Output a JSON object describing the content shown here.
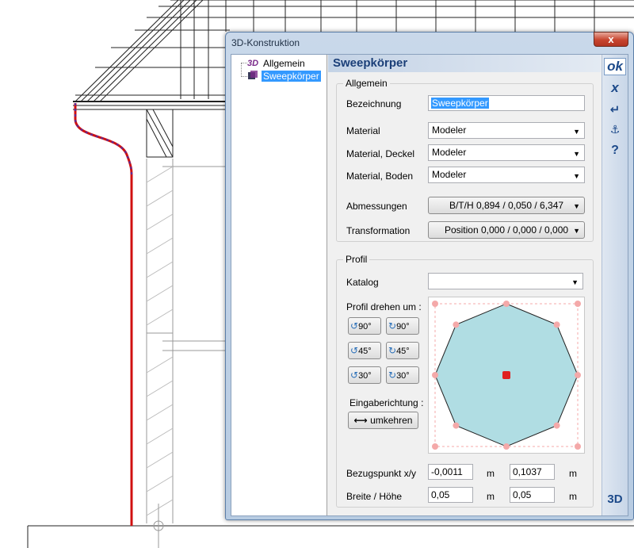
{
  "window": {
    "title": "3D-Konstruktion",
    "close_label": "x"
  },
  "tree": {
    "items": [
      {
        "icon": "3d-icon",
        "icon_text": "3D",
        "label": "Allgemein",
        "selected": false
      },
      {
        "icon": "sweep-body-icon",
        "label": "Sweepkörper",
        "selected": true
      }
    ]
  },
  "main": {
    "heading": "Sweepkörper",
    "general": {
      "title": "Allgemein",
      "bezeichnung_label": "Bezeichnung",
      "bezeichnung_value": "Sweepkörper",
      "material_label": "Material",
      "material_value": "Modeler",
      "material_deckel_label": "Material, Deckel",
      "material_deckel_value": "Modeler",
      "material_boden_label": "Material, Boden",
      "material_boden_value": "Modeler",
      "abmessungen_label": "Abmessungen",
      "abmessungen_value": "B/T/H 0,894 / 0,050 / 6,347",
      "transformation_label": "Transformation",
      "transformation_value": "Position 0,000 / 0,000 / 0,000"
    },
    "profile": {
      "title": "Profil",
      "katalog_label": "Katalog",
      "katalog_value": "",
      "rotate_label": "Profil drehen um :",
      "rotate_buttons": [
        {
          "label": "90°",
          "direction": "ccw"
        },
        {
          "label": "90°",
          "direction": "cw"
        },
        {
          "label": "45°",
          "direction": "ccw"
        },
        {
          "label": "45°",
          "direction": "cw"
        },
        {
          "label": "30°",
          "direction": "ccw"
        },
        {
          "label": "30°",
          "direction": "cw"
        }
      ],
      "input_direction_label": "Eingaberichtung :",
      "reverse_button": "umkehren",
      "bezugspunkt_label": "Bezugspunkt x/y",
      "bezugspunkt_x": "-0,0011",
      "bezugspunkt_y": "0,1037",
      "breite_hoehe_label": "Breite / Höhe",
      "breite": "0,05",
      "hoehe": "0,05",
      "unit": "m",
      "preview_fill": "#b0dde3",
      "vertex_color": "#f4a9a9",
      "center_color": "#e02020"
    }
  },
  "toolbar": {
    "ok": "ok",
    "cancel": "x",
    "enter": "↵",
    "anchor": "⚓",
    "help": "?",
    "view3d": "3D"
  },
  "colors": {
    "accent": "#1b3f78",
    "selection": "#3399ff",
    "profile_line": "#d01010"
  }
}
